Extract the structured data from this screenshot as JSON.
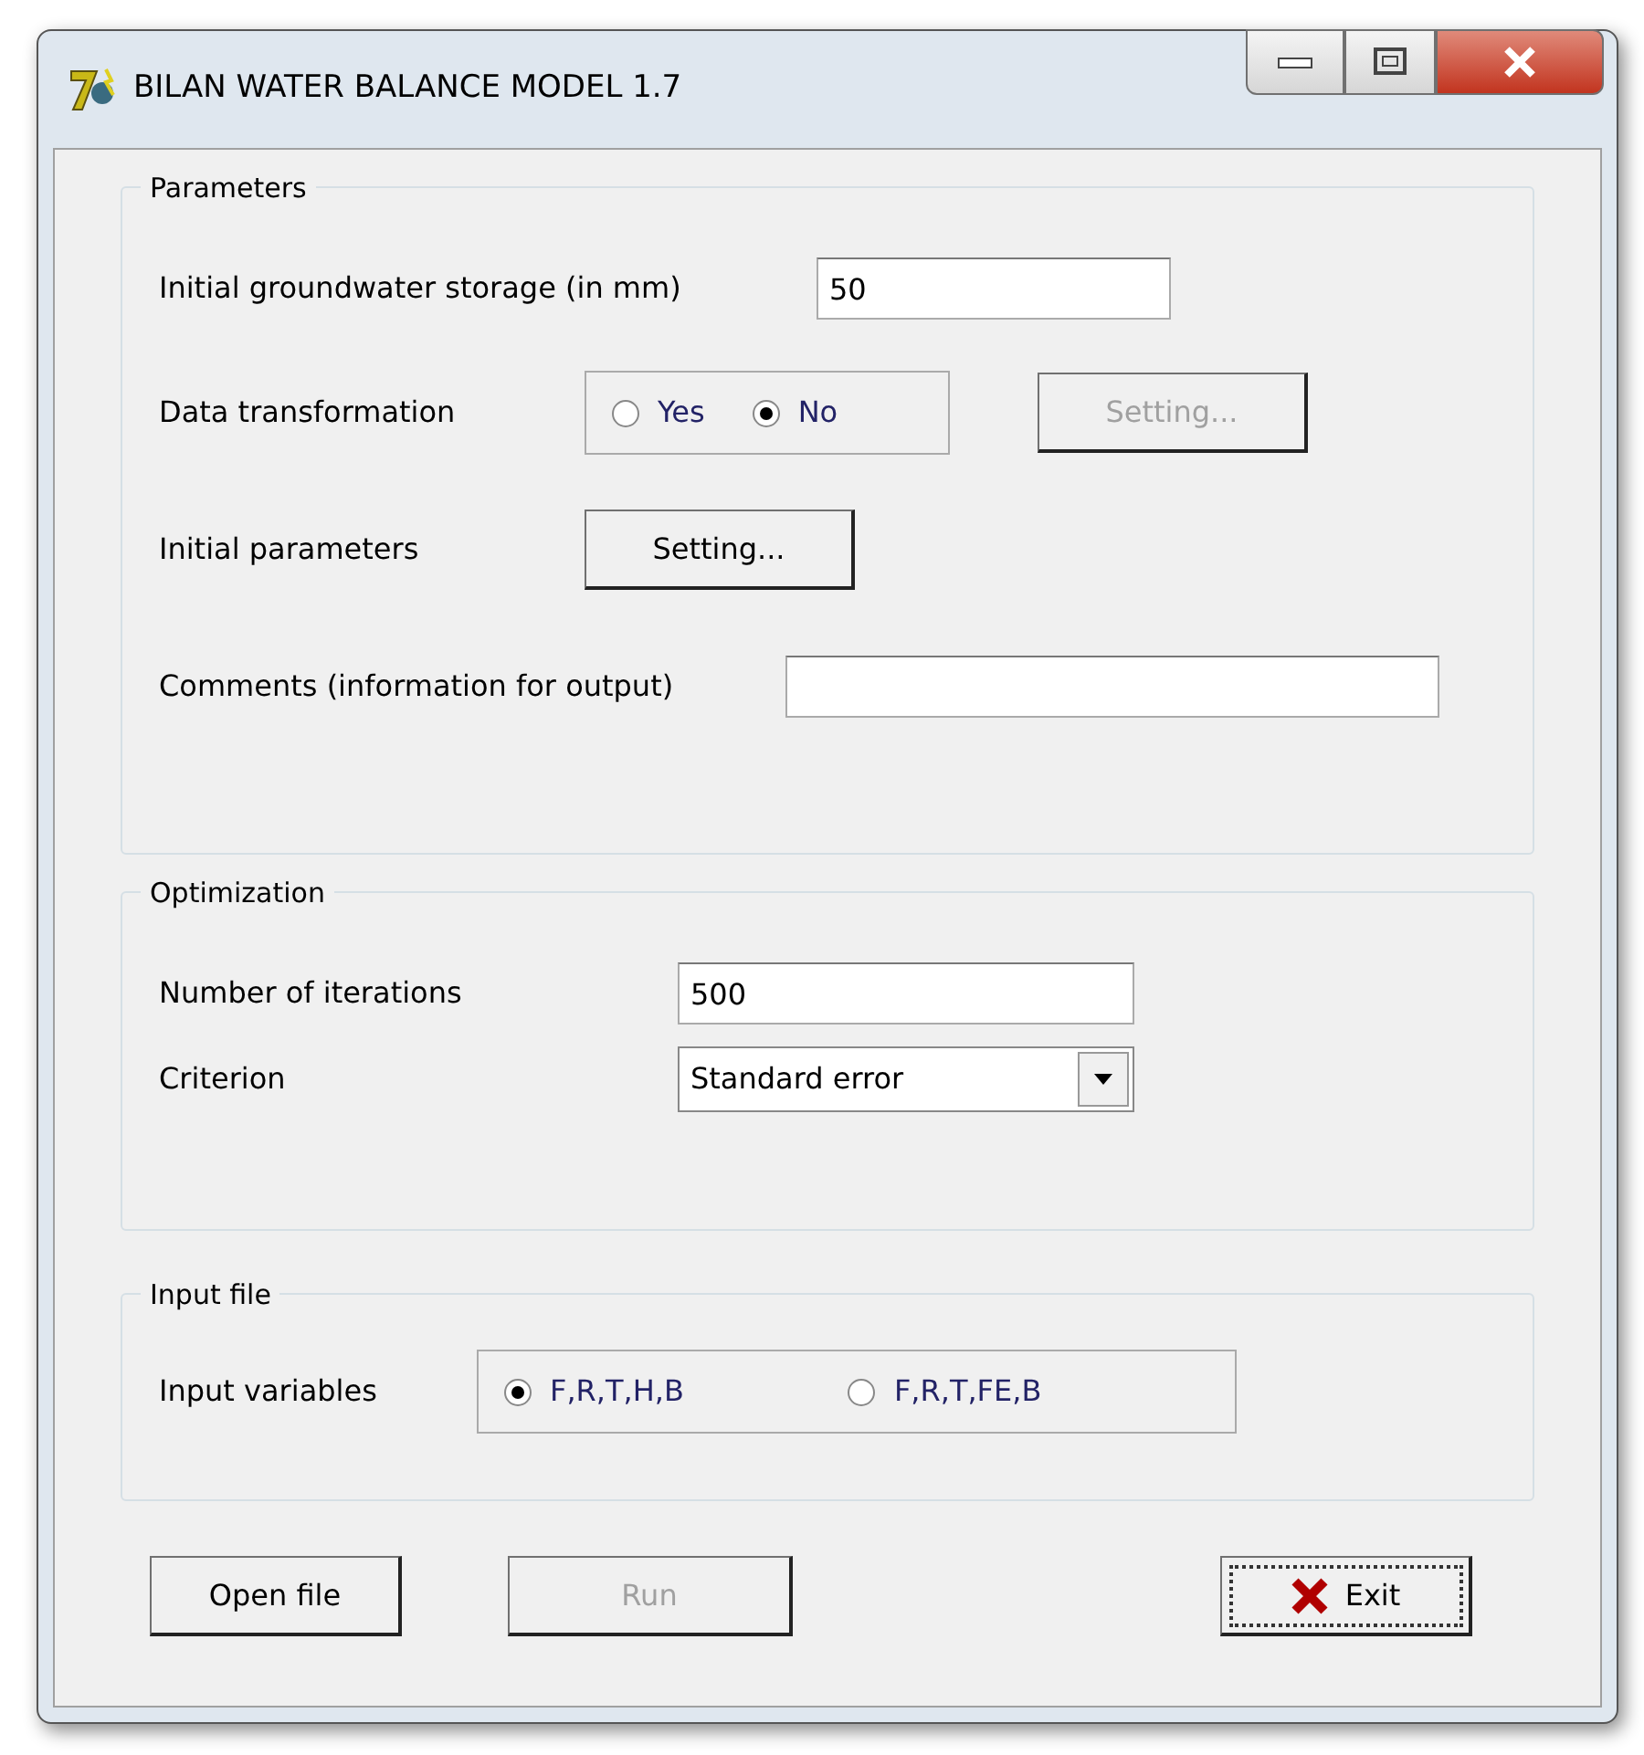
{
  "window": {
    "title": "BILAN WATER BALANCE MODEL 1.7"
  },
  "parameters": {
    "title": "Parameters",
    "groundwater": {
      "label": "Initial groundwater storage (in mm)",
      "value": "50"
    },
    "transformation": {
      "label": "Data transformation",
      "options": [
        {
          "label": "Yes",
          "selected": false
        },
        {
          "label": "No",
          "selected": true
        }
      ],
      "button": {
        "label": "Setting...",
        "disabled": true
      }
    },
    "initial": {
      "label": "Initial parameters",
      "button": {
        "label": "Setting...",
        "disabled": false
      }
    },
    "comments": {
      "label": "Comments (information for output)"
    }
  },
  "optimization": {
    "title": "Optimization",
    "iterations": {
      "label": "Number of iterations",
      "value": "500"
    },
    "criterion": {
      "label": "Criterion",
      "value": "Standard error"
    }
  },
  "input_file": {
    "title": "Input file",
    "label": "Input variables",
    "options": [
      {
        "label": "F,R,T,H,B",
        "selected": true
      },
      {
        "label": "F,R,T,FE,B",
        "selected": false
      }
    ]
  },
  "buttons": [
    {
      "label": "Open file",
      "kind": "plain",
      "disabled": false
    },
    {
      "label": "Run",
      "kind": "plain",
      "disabled": true
    },
    {
      "label": "Exit",
      "kind": "exit",
      "disabled": false
    }
  ]
}
